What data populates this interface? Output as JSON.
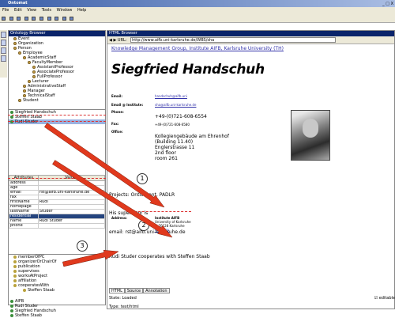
{
  "window": {
    "title": "Ontomat",
    "controls": "_ □ X"
  },
  "menu": [
    "File",
    "Edit",
    "View",
    "Tools",
    "Window",
    "Help"
  ],
  "ontology": {
    "panel_title": "Ontology Browser",
    "tree": [
      {
        "label": "Event",
        "indent": 1
      },
      {
        "label": "Organization",
        "indent": 1
      },
      {
        "label": "Person",
        "indent": 1
      },
      {
        "label": "Employee",
        "indent": 2
      },
      {
        "label": "AcademicStaff",
        "indent": 3
      },
      {
        "label": "FacultyMember",
        "indent": 4
      },
      {
        "label": "AssistantProfessor",
        "indent": 5
      },
      {
        "label": "AssociateProfessor",
        "indent": 5
      },
      {
        "label": "FullProfessor",
        "indent": 5
      },
      {
        "label": "Lecturer",
        "indent": 4
      },
      {
        "label": "AdministrativeStaff",
        "indent": 3
      },
      {
        "label": "Manager",
        "indent": 3
      },
      {
        "label": "TechnicalStaff",
        "indent": 3
      },
      {
        "label": "Student",
        "indent": 2
      }
    ],
    "instances": [
      "Siegfried Handschuh",
      "Steffen Staab",
      "Rudi Studer"
    ],
    "attr_headers": [
      "Attributes",
      "Values"
    ],
    "attributes": [
      {
        "name": "address",
        "value": ""
      },
      {
        "name": "age",
        "value": ""
      },
      {
        "name": "email",
        "value": "rst@aifb.uni-karlsruhe.de"
      },
      {
        "name": "fax",
        "value": ""
      },
      {
        "name": "firstName",
        "value": "Rudi"
      },
      {
        "name": "homepage",
        "value": ""
      },
      {
        "name": "lastName",
        "value": "Studer"
      },
      {
        "name": "residential",
        "value": ""
      },
      {
        "name": "name",
        "value": "Rudi Studer"
      },
      {
        "name": "phone",
        "value": ""
      }
    ],
    "relations": [
      "memberOfPC",
      "organizerOrChairOf",
      "publication",
      "supervises",
      "worksAtProject",
      "affiliation",
      "cooperatesWith",
      "Steffen Staab"
    ],
    "relation_instances": [
      "AIFB",
      "Rudi Studer",
      "Siegfried Handschuh",
      "Steffen Staab"
    ]
  },
  "browser": {
    "panel_title": "HTML Browser",
    "url_label": "URL:",
    "url": "http://www.aifb.uni-karlsruhe.de/WBS/sha",
    "link": "Knowledge Management Group, Institute AIFB, Karlsruhe University (TH)",
    "heading": "Siegfried Handschuh",
    "email_label": "Email:",
    "email_value": "handschuh@aifb.uni",
    "email_inst_label": "Email @ Institute:",
    "email_inst_value": "sha@aifb.uni-karlsruhe.de",
    "phone_label": "Phone:",
    "phone": "+49-(0)721-608-6554",
    "fax_label": "Fax:",
    "fax": "+49-(0)721-608-6580",
    "office_label": "Office:",
    "office_lines": [
      "Kollegiengebäude am Ehrenhof",
      "(Building 11.40)",
      "Englerstrasse 11",
      "2nd floor",
      "room 261"
    ],
    "address_label": "Address:",
    "address_lines": [
      "Institute AIFB",
      "University of Karlsruhe",
      "D-76128 Karlsruhe",
      "Germany"
    ],
    "projects": "Projects: OntoAgent, PADLR",
    "supervisor": "His supervisor is",
    "email_line": "email: rst@aifb.uni-karlsruhe.de",
    "cooperates": "Rudi Studer cooperates with Steffen Staab",
    "tabs": [
      "HTML",
      "Source",
      "Annotation"
    ],
    "status": "State: Loaded",
    "type": "Type: text/html",
    "editable": "editable"
  },
  "callouts": [
    "1",
    "2",
    "3"
  ],
  "colors": {
    "arrow": "#e0391d",
    "selection": "#9ab2e0",
    "highlight": "#24447e"
  }
}
